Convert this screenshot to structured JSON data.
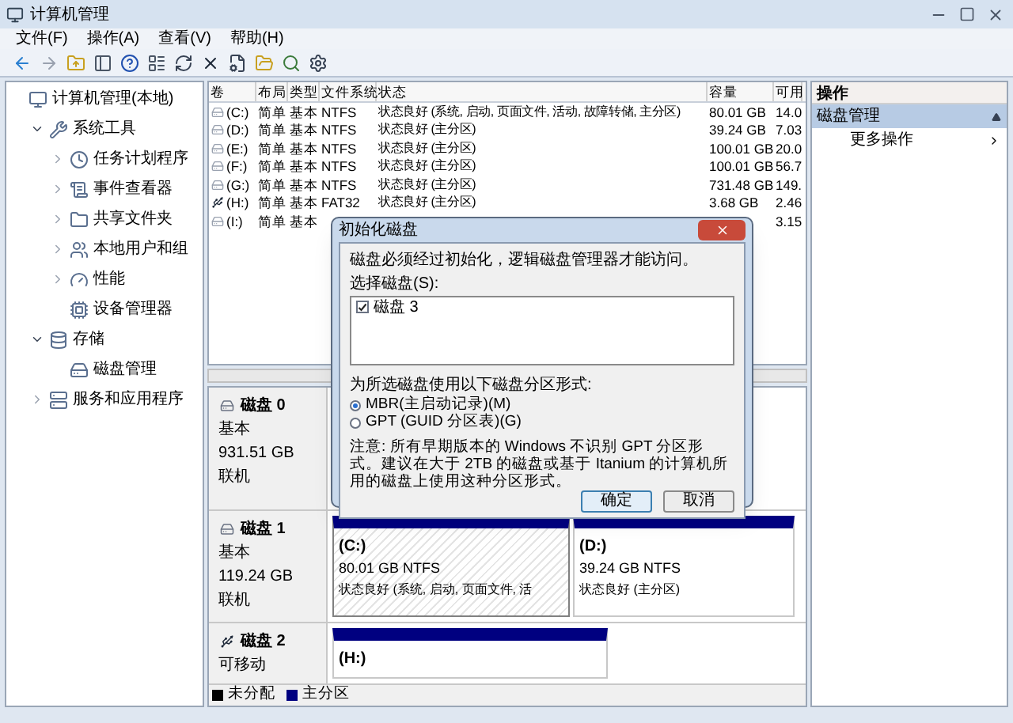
{
  "window": {
    "title": "计算机管理"
  },
  "menu": [
    "文件(F)",
    "操作(A)",
    "查看(V)",
    "帮助(H)"
  ],
  "tree": [
    {
      "label": "计算机管理(本地)",
      "children": [
        {
          "label": "系统工具",
          "expanded": true,
          "children": [
            {
              "label": "任务计划程序",
              "expanded": false
            },
            {
              "label": "事件查看器",
              "expanded": false
            },
            {
              "label": "共享文件夹",
              "expanded": false
            },
            {
              "label": "本地用户和组",
              "expanded": false
            },
            {
              "label": "性能",
              "expanded": false
            },
            {
              "label": "设备管理器"
            }
          ]
        },
        {
          "label": "存储",
          "expanded": true,
          "children": [
            {
              "label": "磁盘管理"
            }
          ]
        },
        {
          "label": "服务和应用程序",
          "expanded": false
        }
      ]
    }
  ],
  "table": {
    "columns": [
      "卷",
      "布局",
      "类型",
      "文件系统",
      "状态",
      "容量",
      "可用"
    ],
    "rows": [
      {
        "volume": "(C:)",
        "layout": "简单",
        "type": "基本",
        "fs": "NTFS",
        "status": "状态良好 (系统, 启动, 页面文件, 活动, 故障转储, 主分区)",
        "capacity": "80.01 GB",
        "free": "14.0",
        "removable": false
      },
      {
        "volume": "(D:)",
        "layout": "简单",
        "type": "基本",
        "fs": "NTFS",
        "status": "状态良好 (主分区)",
        "capacity": "39.24 GB",
        "free": "7.03",
        "removable": false
      },
      {
        "volume": "(E:)",
        "layout": "简单",
        "type": "基本",
        "fs": "NTFS",
        "status": "状态良好 (主分区)",
        "capacity": "100.01 GB",
        "free": "20.0",
        "removable": false
      },
      {
        "volume": "(F:)",
        "layout": "简单",
        "type": "基本",
        "fs": "NTFS",
        "status": "状态良好 (主分区)",
        "capacity": "100.01 GB",
        "free": "56.7",
        "removable": false
      },
      {
        "volume": "(G:)",
        "layout": "简单",
        "type": "基本",
        "fs": "NTFS",
        "status": "状态良好 (主分区)",
        "capacity": "731.48 GB",
        "free": "149.",
        "removable": false
      },
      {
        "volume": "(H:)",
        "layout": "简单",
        "type": "基本",
        "fs": "FAT32",
        "status": "状态良好 (主分区)",
        "capacity": "3.68 GB",
        "free": "2.46",
        "removable": true
      },
      {
        "volume": "(I:)",
        "layout": "简单",
        "type": "基本",
        "free": "3.15",
        "removable": false
      }
    ]
  },
  "disks": [
    {
      "name": "磁盘 0",
      "type": "基本",
      "size": "931.51 GB",
      "state": "联机",
      "removable": false
    },
    {
      "name": "磁盘 1",
      "type": "基本",
      "size": "119.24 GB",
      "state": "联机",
      "removable": false,
      "partitions": [
        {
          "label": "(C:)",
          "info": "80.01 GB NTFS",
          "status": "状态良好 (系统, 启动, 页面文件, 活",
          "selected": true
        },
        {
          "label": "(D:)",
          "info": "39.24 GB NTFS",
          "status": "状态良好 (主分区)",
          "selected": false
        }
      ]
    },
    {
      "name": "磁盘 2",
      "type": "可移动",
      "removable": true,
      "partitions": [
        {
          "label": "(H:)",
          "selected": false
        }
      ]
    }
  ],
  "legend": [
    {
      "label": "未分配",
      "color": "#000000"
    },
    {
      "label": "主分区",
      "color": "#000080"
    }
  ],
  "actions": {
    "header": "操作",
    "section": "磁盘管理",
    "expanded": true,
    "items": [
      "更多操作"
    ]
  },
  "dialog": {
    "title": "初始化磁盘",
    "message": "磁盘必须经过初始化，逻辑磁盘管理器才能访问。",
    "list_label": "选择磁盘(S):",
    "disks": [
      {
        "label": "磁盘 3",
        "checked": true
      }
    ],
    "style_label": "为所选磁盘使用以下磁盘分区形式:",
    "options": [
      {
        "label": "MBR(主启动记录)(M)",
        "selected": true
      },
      {
        "label": "GPT (GUID 分区表)(G)",
        "selected": false
      }
    ],
    "note": "注意: 所有早期版本的 Windows 不识别 GPT 分区形式。建议在大于 2TB 的磁盘或基于 Itanium 的计算机所用的磁盘上使用这种分区形式。",
    "buttons": [
      "确定",
      "取消"
    ]
  }
}
